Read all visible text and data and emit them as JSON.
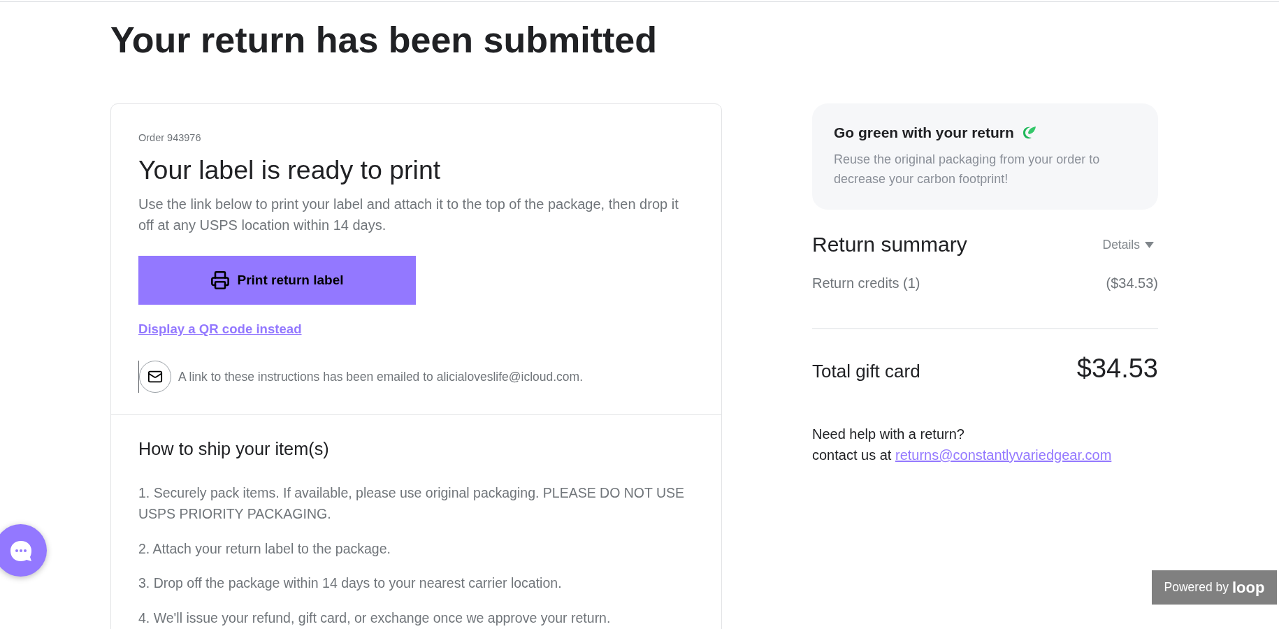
{
  "page": {
    "title": "Your return has been submitted"
  },
  "label_card": {
    "order": "Order 943976",
    "heading": "Your label is ready to print",
    "instructions": "Use the link below to print your label and attach it to the top of the package, then drop it off at any USPS location within 14 days.",
    "print_button": "Print return label",
    "qr_link": "Display a QR code instead",
    "email_notice": "A link to these instructions has been emailed to alicialoveslife@icloud.com."
  },
  "shipping": {
    "heading": "How to ship your item(s)",
    "steps": [
      "1. Securely pack items. If available, please use original packaging. PLEASE DO NOT USE USPS PRIORITY PACKAGING.",
      "2. Attach your return label to the package.",
      "3. Drop off the package within 14 days to your nearest carrier location.",
      "4. We'll issue your refund, gift card, or exchange once we approve your return."
    ]
  },
  "green_card": {
    "title": "Go green with your return",
    "text": "Reuse the original packaging from your order to decrease your carbon footprint!"
  },
  "summary": {
    "title": "Return summary",
    "details": "Details",
    "lines": [
      {
        "label": "Return credits (1)",
        "amount": "($34.53)"
      }
    ],
    "total": {
      "label": "Total gift card",
      "amount": "$34.53"
    }
  },
  "help": {
    "question": "Need help with a return?",
    "prefix": "contact us at",
    "email": "returns@constantlyvariedgear.com"
  },
  "badge": {
    "prefix": "Powered by",
    "brand": "loop"
  }
}
